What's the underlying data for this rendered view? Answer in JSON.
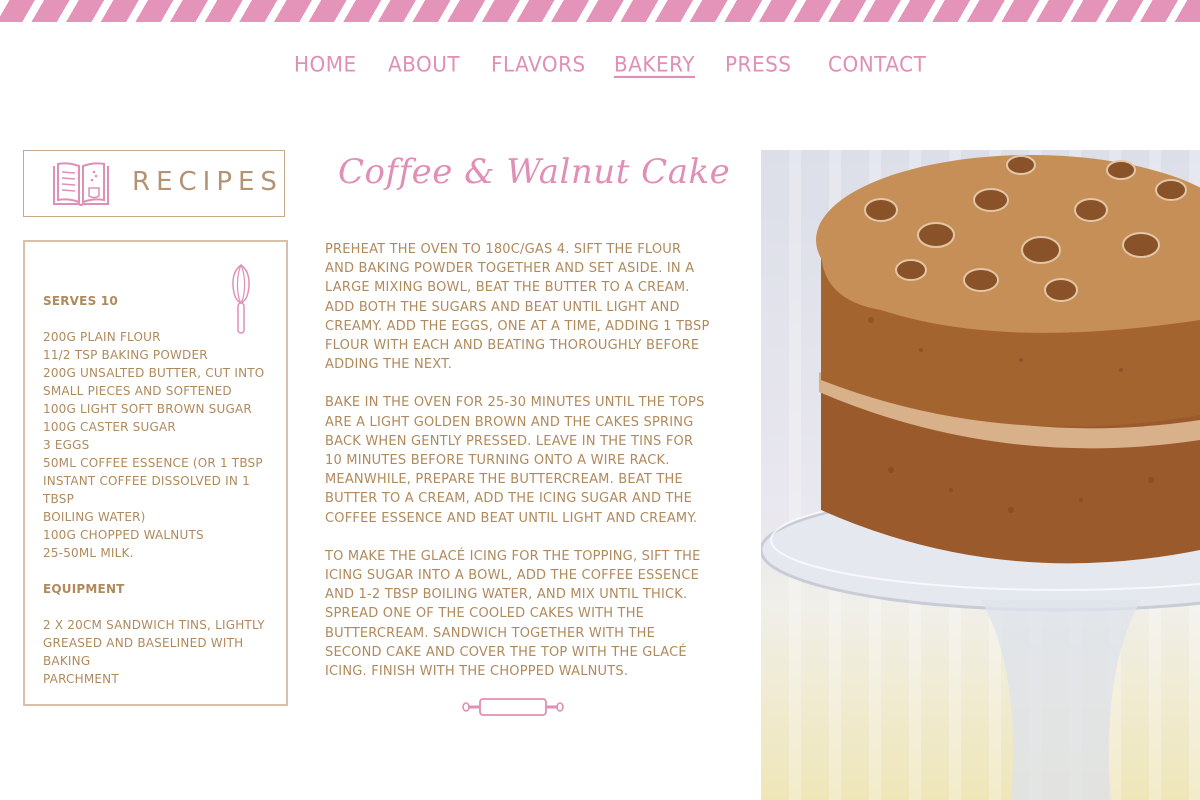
{
  "nav": {
    "items": [
      {
        "label": "HOME"
      },
      {
        "label": "ABOUT"
      },
      {
        "label": "FLAVORS"
      },
      {
        "label": "BAKERY"
      },
      {
        "label": "PRESS"
      },
      {
        "label": "CONTACT"
      }
    ],
    "active": "BAKERY"
  },
  "sidebar": {
    "title": "RECIPES",
    "serves": "SERVES 10",
    "ingredients": [
      "200G PLAIN FLOUR",
      "11/2 TSP BAKING POWDER",
      "200G UNSALTED BUTTER, CUT INTO",
      "SMALL PIECES AND SOFTENED",
      "100G LIGHT SOFT BROWN SUGAR",
      "100G CASTER SUGAR",
      "3 EGGS",
      "50ML COFFEE ESSENCE (OR 1 TBSP",
      "INSTANT COFFEE DISSOLVED IN 1 TBSP",
      "BOILING WATER)",
      "100G CHOPPED WALNUTS",
      "25-50ML MILK."
    ],
    "equipment_heading": "EQUIPMENT",
    "equipment_lines": [
      "2 X 20CM SANDWICH TINS, LIGHTLY",
      "GREASED AND BASELINED WITH BAKING",
      "PARCHMENT"
    ]
  },
  "recipe": {
    "title": "Coffee & Walnut Cake",
    "paragraphs": [
      "PREHEAT THE OVEN TO 180C/GAS 4. SIFT THE FLOUR AND BAKING POWDER TOGETHER AND SET ASIDE. IN A LARGE MIXING BOWL, BEAT THE BUTTER TO A CREAM. ADD BOTH THE SUGARS AND BEAT UNTIL LIGHT AND CREAMY. ADD THE EGGS, ONE AT A TIME, ADDING 1 TBSP FLOUR WITH EACH AND BEATING THOROUGHLY BEFORE ADDING THE NEXT.",
      "BAKE IN THE OVEN FOR 25-30 MINUTES UNTIL THE TOPS ARE A LIGHT GOLDEN BROWN AND THE CAKES SPRING BACK WHEN GENTLY PRESSED. LEAVE IN THE TINS FOR 10 MINUTES BEFORE TURNING ONTO A WIRE RACK. MEANWHILE, PREPARE THE BUTTERCREAM. BEAT THE BUTTER TO A CREAM, ADD THE ICING SUGAR AND THE COFFEE ESSENCE AND BEAT UNTIL LIGHT AND CREAMY.",
      "TO MAKE THE GLACÉ ICING FOR THE TOPPING, SIFT THE ICING SUGAR INTO A BOWL, ADD THE COFFEE ESSENCE AND 1-2 TBSP BOILING WATER, AND MIX UNTIL THICK. SPREAD ONE OF THE COOLED CAKES WITH THE BUTTERCREAM. SANDWICH TOGETHER WITH THE SECOND CAKE AND COVER THE TOP WITH THE GLACÉ ICING. FINISH WITH THE CHOPPED WALNUTS."
    ]
  },
  "colors": {
    "pink": "#e08fb6",
    "stripe_pink": "#e594b9",
    "brown_text": "#b08a5c",
    "border_tan": "#d7bfa8"
  },
  "icons": {
    "recipes_icon": "book-icon",
    "sidebar_decoration": "whisk-icon",
    "divider": "rolling-pin-icon"
  }
}
